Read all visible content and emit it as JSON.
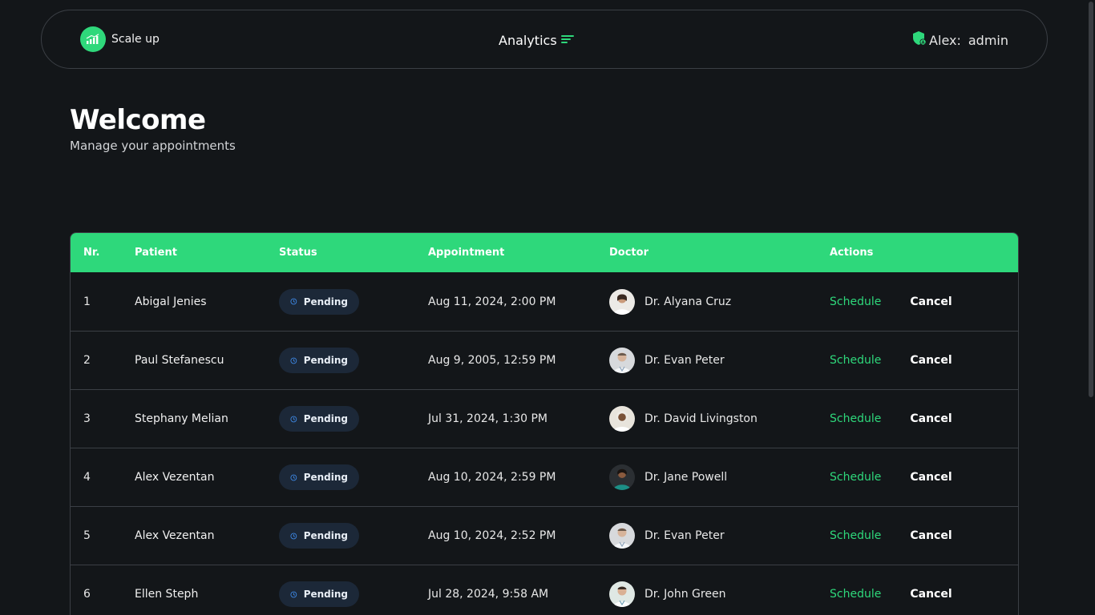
{
  "header": {
    "brand_name": "Scale up",
    "nav_label": "Analytics",
    "user_name": "Alex:",
    "user_role": "admin",
    "accent": "#2ed87b"
  },
  "welcome": {
    "title": "Welcome",
    "subtitle": "Manage your appointments"
  },
  "table": {
    "columns": [
      "Nr.",
      "Patient",
      "Status",
      "Appointment",
      "Doctor",
      "Actions"
    ],
    "schedule_label": "Schedule",
    "cancel_label": "Cancel",
    "rows": [
      {
        "nr": "1",
        "patient": "Abigal Jenies",
        "status": "Pending",
        "appointment": "Aug 11, 2024, 2:00 PM",
        "doctor": "Dr. Alyana Cruz"
      },
      {
        "nr": "2",
        "patient": "Paul Stefanescu",
        "status": "Pending",
        "appointment": "Aug 9, 2005, 12:59 PM",
        "doctor": "Dr. Evan Peter"
      },
      {
        "nr": "3",
        "patient": "Stephany Melian",
        "status": "Pending",
        "appointment": "Jul 31, 2024, 1:30 PM",
        "doctor": "Dr. David Livingston"
      },
      {
        "nr": "4",
        "patient": "Alex Vezentan",
        "status": "Pending",
        "appointment": "Aug 10, 2024, 2:59 PM",
        "doctor": "Dr. Jane Powell"
      },
      {
        "nr": "5",
        "patient": "Alex Vezentan",
        "status": "Pending",
        "appointment": "Aug 10, 2024, 2:52 PM",
        "doctor": "Dr. Evan Peter"
      },
      {
        "nr": "6",
        "patient": "Ellen Steph",
        "status": "Pending",
        "appointment": "Jul 28, 2024, 9:58 AM",
        "doctor": "Dr. John Green"
      }
    ]
  }
}
